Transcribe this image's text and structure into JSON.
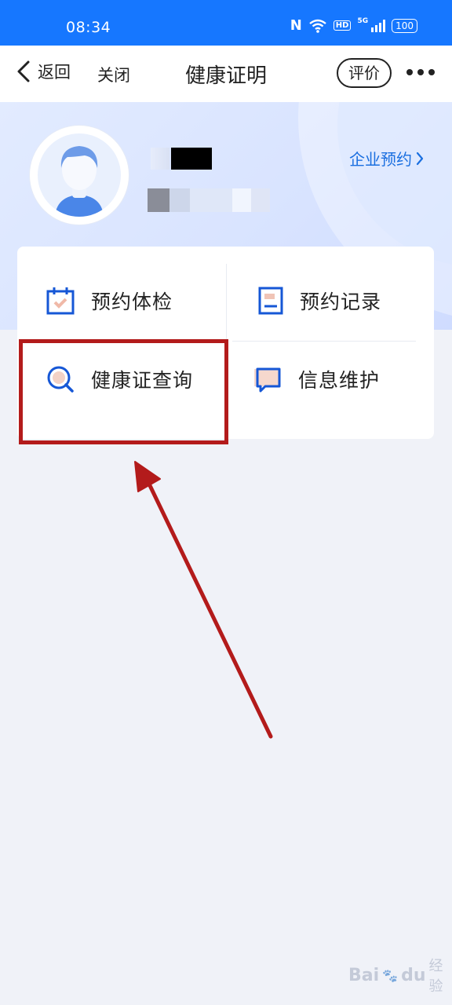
{
  "status_bar": {
    "time": "08:34",
    "nfc": "N",
    "hd": "HD",
    "network": "5G",
    "battery": "100"
  },
  "nav": {
    "back_label": "返回",
    "close_label": "关闭",
    "title": "健康证明",
    "rate_label": "评价"
  },
  "profile": {
    "corp_link": "企业预约"
  },
  "services": [
    {
      "label": "预约体检",
      "icon": "calendar-check-icon"
    },
    {
      "label": "预约记录",
      "icon": "document-icon"
    },
    {
      "label": "健康证查询",
      "icon": "search-icon"
    },
    {
      "label": "信息维护",
      "icon": "chat-edit-icon"
    }
  ],
  "watermark": {
    "brand": "Bai",
    "brand2": "du",
    "suffix": "经验"
  },
  "colors": {
    "status_bar": "#1677ff",
    "accent": "#1a6fe0",
    "highlight": "#b31b1b",
    "background": "#f0f2f8"
  }
}
